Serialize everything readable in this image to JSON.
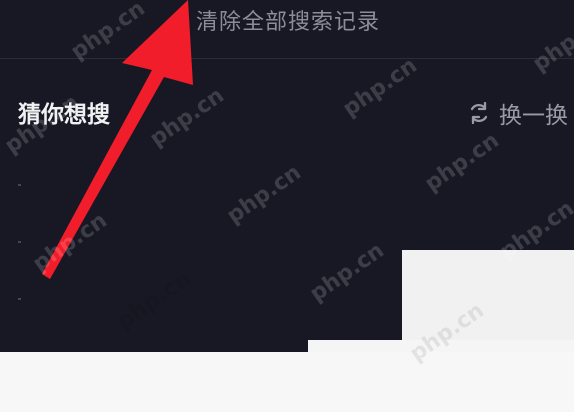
{
  "search_history": {
    "clear_all_label": "清除全部搜索记录"
  },
  "suggestions": {
    "title": "猜你想搜",
    "refresh_label": "换一换",
    "refresh_icon": "refresh-icon"
  },
  "watermark": {
    "text": "php.cn"
  },
  "annotation": {
    "arrow_color": "#f21d2b"
  }
}
